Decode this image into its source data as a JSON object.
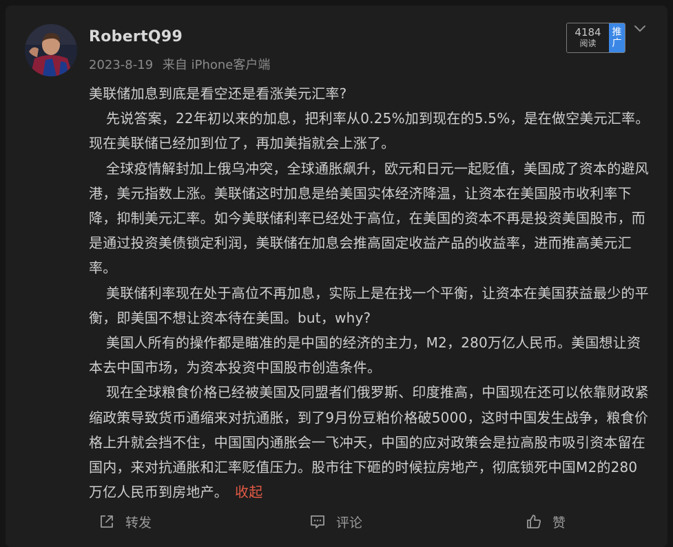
{
  "post": {
    "username": "RobertQ99",
    "date": "2023-8-19",
    "source": "来自 iPhone客户端",
    "read_count": "4184",
    "read_label": "阅读",
    "promote_label_1": "推",
    "promote_label_2": "广",
    "paragraphs": [
      "美联储加息到底是看空还是看涨美元汇率?",
      "先说答案，22年初以来的加息，把利率从0.25%加到现在的5.5%，是在做空美元汇率。现在美联储已经加到位了，再加美指就会上涨了。",
      "全球疫情解封加上俄乌冲突，全球通胀飙升，欧元和日元一起贬值，美国成了资本的避风港，美元指数上涨。美联储这时加息是给美国实体经济降温，让资本在美国股市收利率下降，抑制美元汇率。如今美联储利率已经处于高位，在美国的资本不再是投资美国股市，而是通过投资美债锁定利润，美联储在加息会推高固定收益产品的收益率，进而推高美元汇率。",
      "美联储利率现在处于高位不再加息，实际上是在找一个平衡，让资本在美国获益最少的平衡，即美国不想让资本待在美国。but，why?",
      "美国人所有的操作都是瞄准的是中国的经济的主力，M2，280万亿人民币。美国想让资本去中国市场，为资本投资中国股市创造条件。",
      "现在全球粮食价格已经被美国及同盟者们俄罗斯、印度推高，中国现在还可以依靠财政紧缩政策导致货币通缩来对抗通胀，到了9月份豆粕价格破5000，这时中国发生战争，粮食价格上升就会挡不住，中国国内通胀会一飞冲天，中国的应对政策会是拉高股市吸引资本留在国内，来对抗通胀和汇率贬值压力。股市往下砸的时候拉房地产，彻底锁死中国M2的280万亿人民币到房地产。"
    ],
    "collapse_label": "收起"
  },
  "actions": {
    "share_label": "转发",
    "comment_label": "评论",
    "like_label": "赞"
  },
  "colors": {
    "background": "#1e1e1e",
    "text": "#cfcfcf",
    "accent_collapse": "#e35a45",
    "promote_badge": "#3b87e6"
  },
  "icons": [
    "avatar",
    "chevron-down-icon",
    "share-icon",
    "comment-icon",
    "like-icon"
  ]
}
